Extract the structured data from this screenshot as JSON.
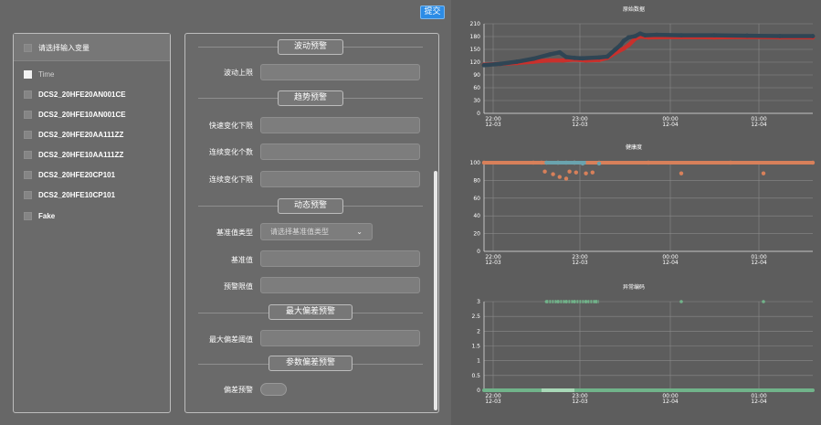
{
  "toolbar": {
    "submit_label": "提交"
  },
  "variables": {
    "header_label": "请选择输入变量",
    "items": [
      {
        "label": "Time",
        "checked": true
      },
      {
        "label": "DCS2_20HFE20AN001CE",
        "checked": false
      },
      {
        "label": "DCS2_20HFE10AN001CE",
        "checked": false
      },
      {
        "label": "DCS2_20HFE20AA111ZZ",
        "checked": false
      },
      {
        "label": "DCS2_20HFE10AA111ZZ",
        "checked": false
      },
      {
        "label": "DCS2_20HFE20CP101",
        "checked": false
      },
      {
        "label": "DCS2_20HFE10CP101",
        "checked": false
      },
      {
        "label": "Fake",
        "checked": false
      }
    ]
  },
  "config": {
    "sections": {
      "fluctuation": "波动预警",
      "trend": "趋势预警",
      "dynamic": "动态预警",
      "max_deviation": "最大偏差预警",
      "param_deviation": "参数偏差预警"
    },
    "fields": {
      "fluctuation_upper": "波动上限",
      "fast_change_lower": "快速变化下限",
      "continuous_count": "连续变化个数",
      "continuous_lower": "连续变化下限",
      "baseline_type": "基准值类型",
      "baseline_type_placeholder": "请选择基准值类型",
      "baseline_value": "基准值",
      "warning_limit": "预警限值",
      "max_deviation_threshold": "最大偏差阈值",
      "deviation_warning": "偏差预警"
    }
  },
  "chart_data": [
    {
      "type": "scatter",
      "title": "原始数据",
      "x_ticks": [
        {
          "time": "22:00",
          "date": "12-03"
        },
        {
          "time": "23:00",
          "date": "12-03"
        },
        {
          "time": "00:00",
          "date": "12-04"
        },
        {
          "time": "01:00",
          "date": "12-04"
        }
      ],
      "x_range": [
        "2023-12-03 21:49",
        "2023-12-04 01:40"
      ],
      "ylim": [
        0,
        210
      ],
      "y_ticks": [
        0,
        30,
        60,
        90,
        120,
        150,
        180,
        210
      ],
      "grid": true,
      "colors": {
        "series_a": "#c9302c",
        "series_b": "#2f4554"
      },
      "series": [
        {
          "values": [
            [
              0,
              114
            ],
            [
              0.1,
              116
            ],
            [
              0.2,
              118
            ],
            [
              0.3,
              121
            ],
            [
              0.35,
              123
            ],
            [
              0.4,
              124
            ],
            [
              0.48,
              124
            ],
            [
              0.55,
              126
            ],
            [
              0.62,
              124
            ],
            [
              0.7,
              125
            ],
            [
              0.75,
              130
            ],
            [
              0.8,
              142
            ],
            [
              0.85,
              152
            ],
            [
              0.88,
              160
            ],
            [
              0.92,
              175
            ],
            [
              0.95,
              180
            ],
            [
              1.0,
              178
            ],
            [
              1.2,
              179
            ],
            [
              1.4,
              178
            ],
            [
              1.6,
              179
            ],
            [
              1.8,
              178
            ],
            [
              2.0,
              178
            ]
          ]
        },
        {
          "values": [
            [
              0,
              113
            ],
            [
              0.1,
              116
            ],
            [
              0.2,
              121
            ],
            [
              0.3,
              128
            ],
            [
              0.4,
              138
            ],
            [
              0.46,
              143
            ],
            [
              0.5,
              132
            ],
            [
              0.55,
              130
            ],
            [
              0.6,
              129
            ],
            [
              0.7,
              131
            ],
            [
              0.75,
              133
            ],
            [
              0.8,
              150
            ],
            [
              0.83,
              160
            ],
            [
              0.85,
              170
            ],
            [
              0.88,
              178
            ],
            [
              0.92,
              181
            ],
            [
              0.95,
              187
            ],
            [
              0.98,
              183
            ],
            [
              1.05,
              184
            ],
            [
              1.2,
              183
            ],
            [
              1.4,
              183
            ],
            [
              1.6,
              182
            ],
            [
              1.8,
              181
            ],
            [
              2.0,
              181
            ]
          ]
        }
      ]
    },
    {
      "type": "scatter",
      "title": "健康度",
      "x_ticks": [
        {
          "time": "22:00",
          "date": "12-03"
        },
        {
          "time": "23:00",
          "date": "12-03"
        },
        {
          "time": "00:00",
          "date": "12-04"
        },
        {
          "time": "01:00",
          "date": "12-04"
        }
      ],
      "ylim": [
        0,
        100
      ],
      "y_ticks": [
        0,
        20,
        40,
        60,
        80,
        100
      ],
      "grid": true,
      "colors": {
        "series_a": "#d8805a",
        "series_b": "#6aa3ae"
      },
      "series": [
        {
          "values": [
            [
              0,
              100
            ],
            [
              0.3,
              100
            ],
            [
              0.35,
              100
            ],
            [
              0.45,
              100
            ],
            [
              0.55,
              100
            ],
            [
              0.7,
              100
            ],
            [
              1.0,
              100
            ],
            [
              1.5,
              100
            ],
            [
              2.0,
              100
            ]
          ]
        },
        {
          "values": [
            [
              0.38,
              100
            ],
            [
              0.45,
              100
            ],
            [
              0.5,
              100
            ],
            [
              0.55,
              100
            ],
            [
              0.6,
              99
            ],
            [
              0.7,
              99
            ]
          ]
        },
        {
          "values": [
            [
              0.37,
              90
            ],
            [
              0.42,
              87
            ],
            [
              0.46,
              84
            ],
            [
              0.5,
              82
            ],
            [
              0.52,
              90
            ],
            [
              0.56,
              89
            ],
            [
              0.62,
              88
            ],
            [
              0.66,
              89
            ],
            [
              1.2,
              88
            ],
            [
              1.7,
              88
            ]
          ]
        }
      ]
    },
    {
      "type": "scatter",
      "title": "异常编码",
      "x_ticks": [
        {
          "time": "22:00",
          "date": "12-03"
        },
        {
          "time": "23:00",
          "date": "12-03"
        },
        {
          "time": "00:00",
          "date": "12-04"
        },
        {
          "time": "01:00",
          "date": "12-04"
        }
      ],
      "ylim": [
        0,
        3
      ],
      "y_ticks": [
        0,
        0.5,
        1,
        1.5,
        2,
        2.5,
        3
      ],
      "grid": true,
      "colors": {
        "series_a": "#71b38a",
        "series_b": "#a8d8b7"
      },
      "series": [
        {
          "values": [
            [
              0.38,
              3
            ],
            [
              0.45,
              3
            ],
            [
              0.5,
              3
            ],
            [
              0.55,
              3
            ],
            [
              0.62,
              3
            ],
            [
              0.68,
              3
            ],
            [
              1.2,
              3
            ],
            [
              1.7,
              3
            ]
          ]
        },
        {
          "values": [
            [
              0,
              0
            ],
            [
              0.3,
              0
            ],
            [
              0.6,
              0
            ],
            [
              0.9,
              0
            ],
            [
              1.2,
              0
            ],
            [
              1.5,
              0
            ],
            [
              1.8,
              0
            ],
            [
              2.0,
              0
            ]
          ]
        }
      ]
    }
  ]
}
